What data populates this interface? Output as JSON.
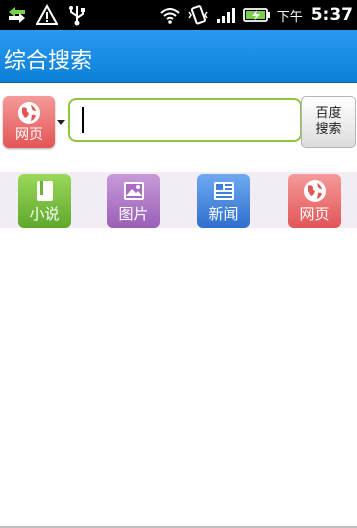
{
  "status_bar": {
    "time": "5:37",
    "am_pm": "下午",
    "icons": [
      "usb-transfer-icon",
      "warning-icon",
      "usb-icon",
      "wifi-icon",
      "vibrate-icon",
      "signal-icon",
      "battery-charging-icon"
    ]
  },
  "title_bar": {
    "title": "综合搜索"
  },
  "search": {
    "engine_label": "网页",
    "input_value": "",
    "button_line1": "百度",
    "button_line2": "搜索"
  },
  "categories": [
    {
      "label": "小说",
      "icon": "book-icon",
      "color": "#6db33f"
    },
    {
      "label": "图片",
      "icon": "image-icon",
      "color": "#a86cc6"
    },
    {
      "label": "新闻",
      "icon": "news-icon",
      "color": "#3f80dc"
    },
    {
      "label": "网页",
      "icon": "globe-icon",
      "color": "#e85b5b"
    }
  ],
  "colors": {
    "title_bar": "#1a8de6",
    "input_border": "#8cc63f",
    "category_bar_bg": "#f2edf5"
  }
}
